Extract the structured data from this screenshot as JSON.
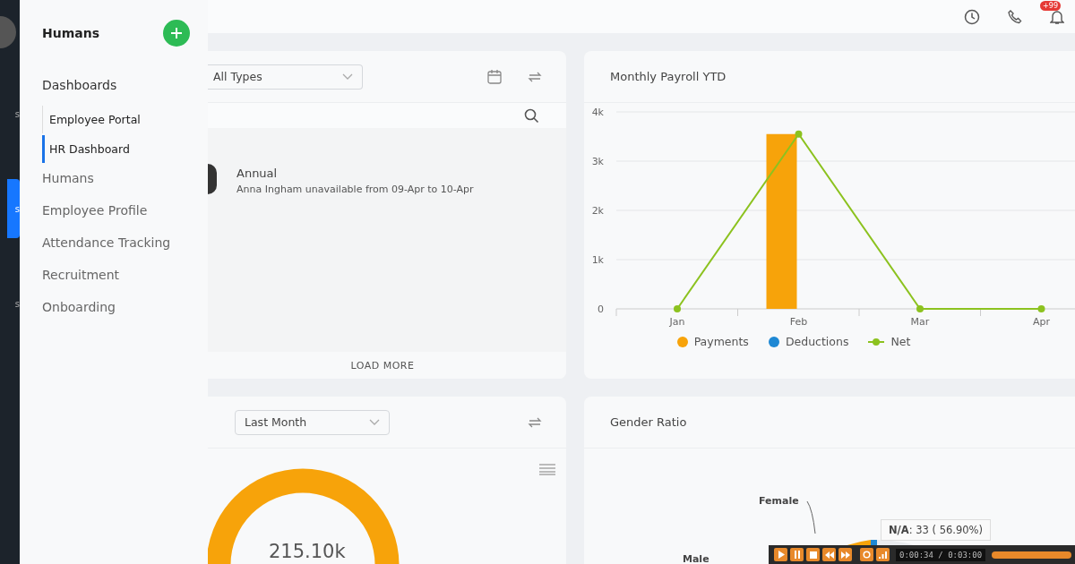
{
  "rail": {
    "items": [
      {
        "label": "s",
        "selected": false
      },
      {
        "label": "s",
        "selected": true
      },
      {
        "label": "s",
        "selected": false
      }
    ]
  },
  "sidebar": {
    "title": "Humans",
    "sections": [
      {
        "label": "Dashboards",
        "children": [
          {
            "label": "Employee Portal",
            "selected": false
          },
          {
            "label": "HR Dashboard",
            "selected": true
          }
        ]
      }
    ],
    "items": [
      "Humans",
      "Employee Profile",
      "Attendance Tracking",
      "Recruitment",
      "Onboarding"
    ]
  },
  "header": {
    "notification_badge": "+99"
  },
  "leave_card": {
    "filter": "All Types",
    "entries": [
      {
        "title": "Annual",
        "detail": "Anna Ingham unavailable from 09-Apr to 10-Apr"
      }
    ],
    "load_more": "LOAD MORE"
  },
  "payroll_card": {
    "title": "Monthly Payroll YTD",
    "chart_data": {
      "type": "bar",
      "categories": [
        "Jan",
        "Feb",
        "Mar",
        "Apr"
      ],
      "series": [
        {
          "name": "Payments",
          "color": "#f7a30a",
          "values": [
            0,
            3550,
            0,
            0
          ]
        },
        {
          "name": "Deductions",
          "color": "#1e88d4",
          "values": [
            0,
            0,
            0,
            0
          ]
        },
        {
          "name": "Net",
          "color": "#8cc21f",
          "type": "line",
          "marker": "circle",
          "values": [
            0,
            3550,
            0,
            0
          ]
        }
      ],
      "grid": true,
      "legend": "bottom",
      "ylim": [
        0,
        4000
      ],
      "yticks": [
        {
          "value": 0,
          "label": "0"
        },
        {
          "value": 1000,
          "label": "1k"
        },
        {
          "value": 2000,
          "label": "2k"
        },
        {
          "value": 3000,
          "label": "3k"
        },
        {
          "value": 4000,
          "label": "4k"
        }
      ]
    }
  },
  "total_card": {
    "filter": "Last Month",
    "total": "215.10k"
  },
  "gender_card": {
    "title": "Gender Ratio",
    "labels": [
      "Female",
      "Male"
    ],
    "tooltip": {
      "name": "N/A",
      "value": ": 33 ( 56.90%)"
    }
  },
  "media_player": {
    "time": "0:00:34 / 0:03:00"
  }
}
